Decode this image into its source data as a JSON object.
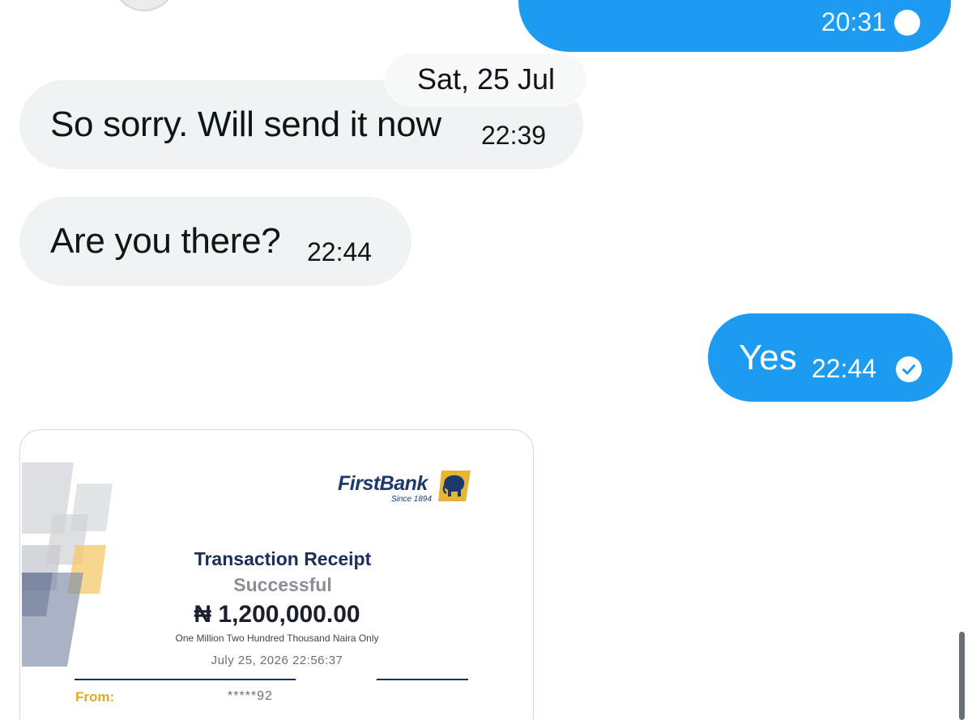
{
  "chat": {
    "top_outgoing": {
      "time": "20:31"
    },
    "date_divider": "Sat, 25 Jul",
    "messages": [
      {
        "direction": "incoming",
        "text": "So sorry. Will send it now",
        "time": "22:39"
      },
      {
        "direction": "incoming",
        "text": "Are you there?",
        "time": "22:44"
      },
      {
        "direction": "outgoing",
        "text": "Yes",
        "time": "22:44",
        "status": "sent"
      }
    ],
    "attachment": {
      "type": "image",
      "receipt": {
        "bank_name": "FirstBank",
        "bank_since": "Since 1894",
        "title": "Transaction Receipt",
        "status": "Successful",
        "amount": "₦ 1,200,000.00",
        "amount_words": "One Million Two Hundred Thousand Naira Only",
        "datetime": "July 25, 2026 22:56:37",
        "from_label": "From:",
        "from_value": "*****92"
      }
    }
  },
  "colors": {
    "outgoing_bubble": "#1d9bf0",
    "incoming_bubble": "#eff3f4",
    "text": "#0f1419",
    "bank_navy": "#1b2e55",
    "bank_gold": "#e0a92a"
  },
  "icons": {
    "sent_status": "check-circle-icon",
    "avatar": "avatar"
  }
}
